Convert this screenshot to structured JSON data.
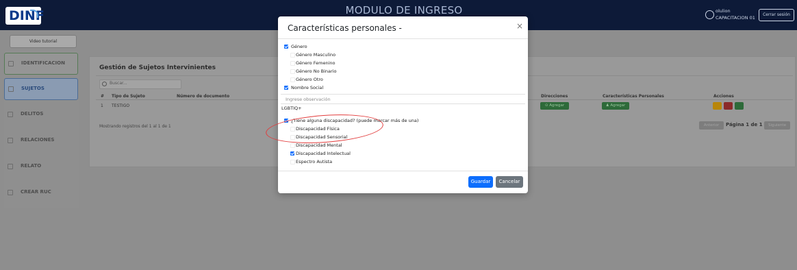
{
  "header": {
    "logo_text": "DINF",
    "app_title": "MODULO DE INGRESO",
    "user_name": "olulion",
    "user_role": "CAPACITACION 01",
    "logout_label": "Cerrar sesión"
  },
  "sidebar": {
    "video_label": "Video tutorial",
    "items": [
      {
        "label": "IDENTIFICACION"
      },
      {
        "label": "SUJETOS"
      },
      {
        "label": "DELITOS"
      },
      {
        "label": "RELACIONES"
      },
      {
        "label": "RELATO"
      },
      {
        "label": "CREAR RUC"
      }
    ]
  },
  "main": {
    "title": "Gestión de Sujetos Intervinientes",
    "search_placeholder": "Buscar...",
    "columns": {
      "num": "#",
      "tipo": "Tipo de Sujeto",
      "documento": "Número de documento",
      "direcciones": "Direcciones",
      "caracteristicas": "Características Personales",
      "acciones": "Acciones"
    },
    "rows": [
      {
        "num": "1",
        "tipo": "TESTIGO",
        "dir_btn": "Agregar",
        "car_btn": "Agregar"
      }
    ],
    "showing_text": "Mostrando registros del 1 al 1 de 1",
    "pager": {
      "prev": "Anterior",
      "info": "Página 1 de 1",
      "next": "Siguiente"
    }
  },
  "modal": {
    "title": "Características personales -",
    "close": "×",
    "genero_label": "Género",
    "genero_options": [
      {
        "label": "Género Masculino",
        "checked": false
      },
      {
        "label": "Género Femenino",
        "checked": false
      },
      {
        "label": "Género No Binario",
        "checked": false
      },
      {
        "label": "Género Otro",
        "checked": false
      }
    ],
    "nombre_social_label": "Nombre Social",
    "observacion_placeholder": "Ingrese observación",
    "lgbtiq_label": "LGBTIQ+",
    "discapacidad_label": "¿Tiene alguna discapacidad? (puede marcar más de una)",
    "discapacidad_options": [
      {
        "label": "Discapacidad Física",
        "checked": false
      },
      {
        "label": "Discapacidad Sensorial",
        "checked": false
      },
      {
        "label": "Discapacidad Mental",
        "checked": false
      },
      {
        "label": "Discapacidad Intelectual",
        "checked": true
      },
      {
        "label": "Espectro Autista",
        "checked": false
      }
    ],
    "save_label": "Guardar",
    "cancel_label": "Cancelar"
  },
  "colors": {
    "primary": "#0d6efd",
    "secondary": "#6c757d",
    "header_bg": "#0d1a38",
    "annotation": "#e23b3b"
  }
}
